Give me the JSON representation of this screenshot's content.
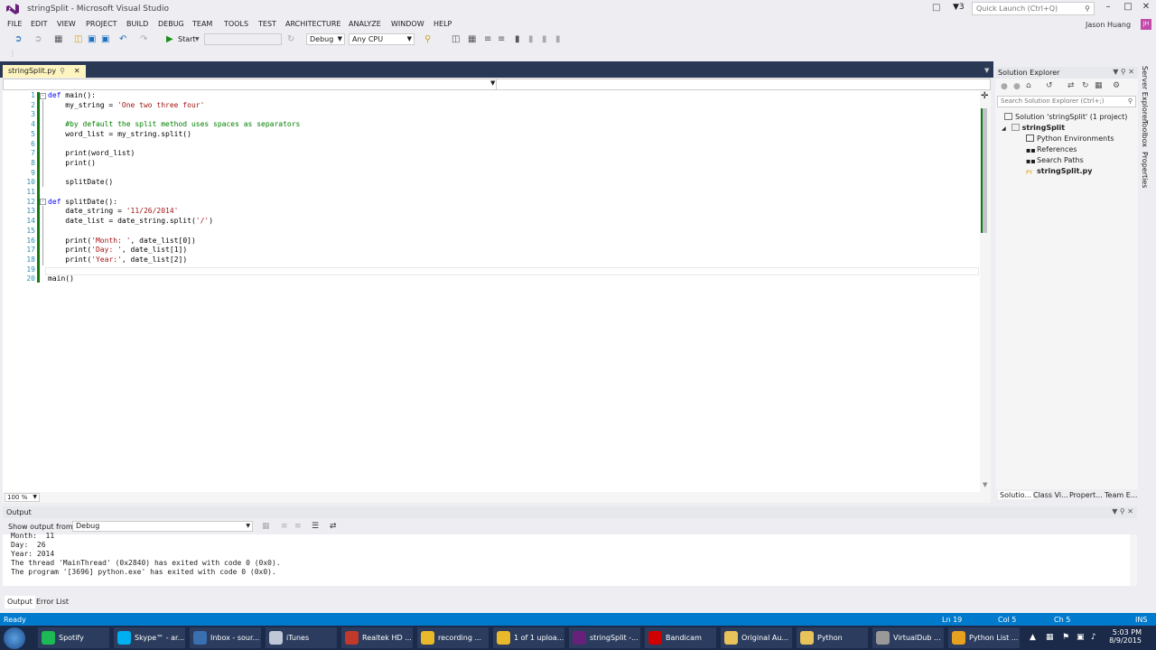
{
  "window": {
    "title": "stringSplit - Microsoft Visual Studio",
    "notify_count": "3",
    "quick_launch": "Quick Launch (Ctrl+Q)",
    "user": "Jason Huang",
    "avatar": "JH"
  },
  "menu": [
    "FILE",
    "EDIT",
    "VIEW",
    "PROJECT",
    "BUILD",
    "DEBUG",
    "TEAM",
    "TOOLS",
    "TEST",
    "ARCHITECTURE",
    "ANALYZE",
    "WINDOW",
    "HELP"
  ],
  "toolbar": {
    "start": "Start",
    "config": "Debug",
    "platform": "Any CPU"
  },
  "editor": {
    "tab": "stringSplit.py",
    "zoom": "100 %",
    "lines": [
      {
        "n": "1",
        "code": "def main():"
      },
      {
        "n": "2",
        "code": "    my_string = 'One two three four'"
      },
      {
        "n": "3",
        "code": ""
      },
      {
        "n": "4",
        "code": "    #by default the split method uses spaces as separators"
      },
      {
        "n": "5",
        "code": "    word_list = my_string.split()"
      },
      {
        "n": "6",
        "code": ""
      },
      {
        "n": "7",
        "code": "    print(word_list)"
      },
      {
        "n": "8",
        "code": "    print()"
      },
      {
        "n": "9",
        "code": ""
      },
      {
        "n": "10",
        "code": "    splitDate()"
      },
      {
        "n": "11",
        "code": ""
      },
      {
        "n": "12",
        "code": "def splitDate():"
      },
      {
        "n": "13",
        "code": "    date_string = '11/26/2014'"
      },
      {
        "n": "14",
        "code": "    date_list = date_string.split('/')"
      },
      {
        "n": "15",
        "code": ""
      },
      {
        "n": "16",
        "code": "    print('Month: ', date_list[0])"
      },
      {
        "n": "17",
        "code": "    print('Day: ', date_list[1])"
      },
      {
        "n": "18",
        "code": "    print('Year:', date_list[2])"
      },
      {
        "n": "19",
        "code": ""
      },
      {
        "n": "20",
        "code": "main()"
      }
    ]
  },
  "solution_explorer": {
    "title": "Solution Explorer",
    "search": "Search Solution Explorer (Ctrl+;)",
    "solution": "Solution 'stringSplit' (1 project)",
    "project": "stringSplit",
    "items": [
      "Python Environments",
      "References",
      "Search Paths",
      "stringSplit.py"
    ],
    "tabs": [
      "Solutio...",
      "Class Vi...",
      "Propert...",
      "Team E..."
    ],
    "side_tabs": [
      "Server Explorer",
      "Toolbox",
      "Properties"
    ]
  },
  "output": {
    "title": "Output",
    "show_from_label": "Show output from:",
    "source": "Debug",
    "lines": [
      "Month:  11",
      "Day:  26",
      "Year: 2014",
      "The thread 'MainThread' (0x2840) has exited with code 0 (0x0).",
      "The program '[3696] python.exe' has exited with code 0 (0x0)."
    ],
    "tabs": [
      "Output",
      "Error List"
    ]
  },
  "status": {
    "state": "Ready",
    "ln": "Ln 19",
    "col": "Col 5",
    "ch": "Ch 5",
    "mode": "INS"
  },
  "taskbar": {
    "items": [
      {
        "label": "Spotify",
        "color": "#1db954"
      },
      {
        "label": "Skype™ - ar...",
        "color": "#00aff0"
      },
      {
        "label": "Inbox - sour...",
        "color": "#3a6fb0"
      },
      {
        "label": "iTunes",
        "color": "#c0c8d8"
      },
      {
        "label": "Realtek HD ...",
        "color": "#c0392b"
      },
      {
        "label": "recording ...",
        "color": "#e8b92a"
      },
      {
        "label": "1 of 1 uploa...",
        "color": "#e8b92a"
      },
      {
        "label": "stringSplit -...",
        "color": "#68217a"
      },
      {
        "label": "Bandicam",
        "color": "#d00000"
      },
      {
        "label": "Original Au...",
        "color": "#e8c25a"
      },
      {
        "label": "Python",
        "color": "#e8c25a"
      },
      {
        "label": "VirtualDub ...",
        "color": "#999999"
      },
      {
        "label": "Python List ...",
        "color": "#e8a020"
      }
    ],
    "time": "5:03 PM",
    "date": "8/9/2015"
  }
}
